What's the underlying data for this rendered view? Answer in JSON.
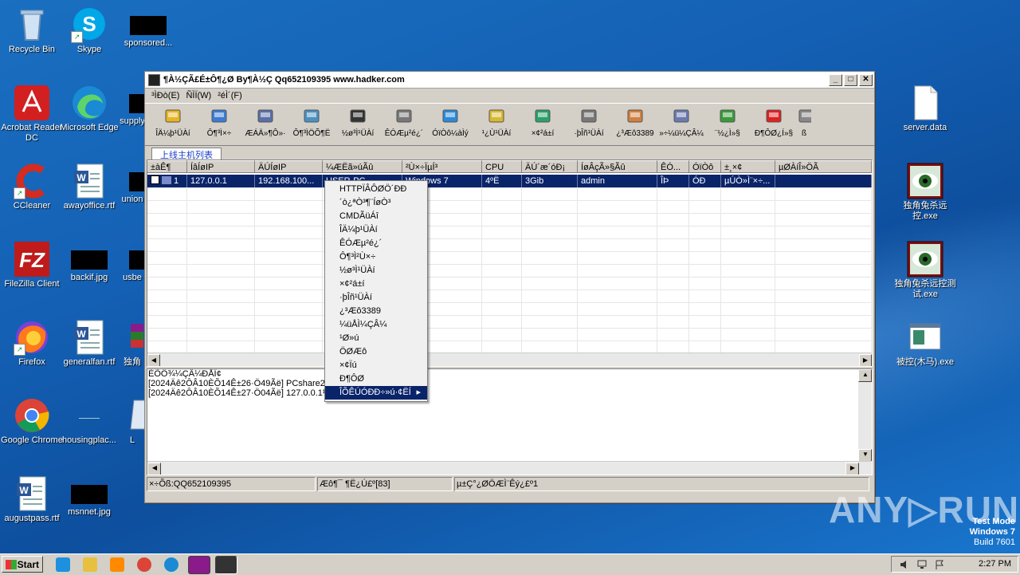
{
  "desktop": {
    "icons": [
      {
        "label": "Recycle Bin"
      },
      {
        "label": "Skype"
      },
      {
        "label": "sponsored..."
      },
      {
        "label": "Acrobat Reader DC"
      },
      {
        "label": "Microsoft Edge"
      },
      {
        "label": "supply"
      },
      {
        "label": "CCleaner"
      },
      {
        "label": "awayoffice.rtf"
      },
      {
        "label": "union"
      },
      {
        "label": "FileZilla Client"
      },
      {
        "label": "backif.jpg"
      },
      {
        "label": "usbe"
      },
      {
        "label": "Firefox"
      },
      {
        "label": "generalfan.rtf"
      },
      {
        "label": "独角"
      },
      {
        "label": "Google Chrome"
      },
      {
        "label": "housingplac..."
      },
      {
        "label": "L"
      },
      {
        "label": "augustpass.rtf"
      },
      {
        "label": "msnnet.jpg"
      },
      {
        "label": "server.data"
      },
      {
        "label": "独角兔杀远控.exe"
      },
      {
        "label": "独角兔杀远控测试.exe"
      },
      {
        "label": "被控(木马).exe"
      }
    ]
  },
  "window": {
    "title": "¶À½ÇÃ£É±Ô¶¿Ø By¶À½Ç Qq652109395 www.hadker.com",
    "menu": [
      "³ÌÐò(E)",
      "ÑÌÏ(W)",
      "²éÌ´(F)"
    ],
    "toolbar": [
      {
        "label": "ÎÄ¼þ¹ÜÀí",
        "icon": "folder-icon",
        "color": "#e8b422"
      },
      {
        "label": "Ô¶³Ì×÷",
        "icon": "monitor-icon",
        "color": "#3a7bd5"
      },
      {
        "label": "ÆÁÄ»¶Ô»·",
        "icon": "screen-icon",
        "color": "#5a6fa8"
      },
      {
        "label": "Ô¶³ÌÖÕ¶Ë",
        "icon": "terminal-icon",
        "color": "#4a90c2"
      },
      {
        "label": "½ø³Ì¹ÜÀí",
        "icon": "process-icon",
        "color": "#333333"
      },
      {
        "label": "ÊÓÆµ²é¿´",
        "icon": "webcam-icon",
        "color": "#777777"
      },
      {
        "label": "ÓïÒô¼àÌý",
        "icon": "phone-icon",
        "color": "#2a8ad8"
      },
      {
        "label": "¹¿Ù¹ÜÀí",
        "icon": "service-icon",
        "color": "#d8b830"
      },
      {
        "label": "×¢²á±í",
        "icon": "registry-icon",
        "color": "#2aa06a"
      },
      {
        "label": "·þÎñ¹ÜÀí",
        "icon": "gear-icon",
        "color": "#777777"
      },
      {
        "label": "¿³Æô3389",
        "icon": "user-icon",
        "color": "#d08040"
      },
      {
        "label": "»÷¼ü¼ÇÂ¼",
        "icon": "keylog-icon",
        "color": "#6a7ab0"
      },
      {
        "label": "¨½¿Ì»§",
        "icon": "users-icon",
        "color": "#3a9a3a"
      },
      {
        "label": "Ð¶ÔØ¿Í»§",
        "icon": "uninstall-icon",
        "color": "#e02020"
      },
      {
        "label": "ß",
        "icon": "more-icon",
        "color": "#888888"
      }
    ],
    "tab": "上线主机列表",
    "columns": [
      "±àÊ¶",
      "ÍâÍøIP",
      "ÄÚÍøIP",
      "¼ÆËã»úÃû",
      "²Ù×÷ÏµÍ³",
      "CPU",
      "ÄÚ´æ´óÐ¡",
      "ÍøÂçÃ»§Ãû",
      "ÊÓ...",
      "ÓïÒô",
      "±¸×¢",
      "µØÀíÎ»ÖÃ"
    ],
    "row": {
      "id": "1",
      "wan_ip": "127.0.0.1",
      "lan_ip": "192.168.100...",
      "host": "USER-PC",
      "os": "Windows 7",
      "cpu": "4ºË",
      "mem": "3Gib",
      "user": "admin",
      "video": "ÎÞ",
      "voice": "ÓÐ",
      "note": "µÚÒ»Ì¨×÷...",
      "geo": ""
    },
    "log": {
      "header": "ÈÕÖ¾¼ÇÂ¼ÐÅÏ¢",
      "lines": [
        "[2024Äê2ÔÂ10ÈÕ14Ê±26·Ö49Ãë]  PCshare20...",
        "[2024Äê2ÔÂ10ÈÕ14Ê±27·Ö04Ãë]  127.0.0.1½ø..."
      ],
      "line1_tail": "¹",
      "line2_tail": ""
    },
    "status": [
      "×÷Õß:QQ652109395",
      "Æô¶¯ ¶Ë¿Ú£º[83]",
      "µ±Ç°¿ØÖÆÌ¨Êý¿£º1"
    ]
  },
  "context_menu": {
    "items": [
      "HTTPÏÂÔØÖ´ÐÐ",
      "´ò¿ªÒ³¶¨ÍøÒ³",
      "CMDÃüÁî",
      "ÎÄ¼þ¹ÜÀí",
      "ÊÓÆµ²é¿´",
      "Ô¶³Ì²Ù×÷",
      "½ø³Ì¹ÜÀí",
      "×¢²á±í",
      "·þÎñ¹ÜÀí",
      "¿³Æô3389",
      "¼üÅÌ¼ÇÂ¼",
      "¹Ø»ú",
      "ÖØÆô",
      "×¢Ïú",
      "Ð¶ÔØ",
      "ÎÕÊÚÓÐÐ÷»ú·¢ËÍ"
    ],
    "selected_index": 15
  },
  "taskbar": {
    "start": "Start",
    "clock": "2:27 PM",
    "icons": [
      "ie-icon",
      "explorer-icon",
      "media-player-icon",
      "chrome-icon",
      "edge-icon",
      "winrar-icon",
      "remote-tool-icon"
    ]
  },
  "watermark": "ANY▷RUN",
  "testmode": {
    "line1": "Test Mode",
    "line2": "Windows 7",
    "line3": "Build 7601"
  }
}
